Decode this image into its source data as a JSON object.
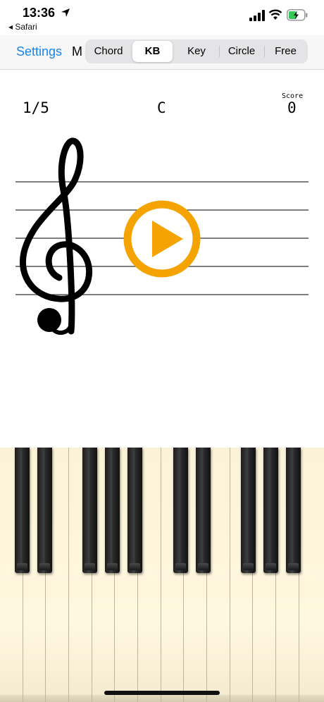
{
  "status_bar": {
    "time": "13:36",
    "back_app": "◂ Safari"
  },
  "nav": {
    "settings_label": "Settings",
    "title_fragment": "M",
    "tabs": [
      {
        "label": "Chord",
        "selected": false
      },
      {
        "label": "KB",
        "selected": true
      },
      {
        "label": "Key",
        "selected": false
      },
      {
        "label": "Circle",
        "selected": false
      },
      {
        "label": "Free",
        "selected": false
      }
    ]
  },
  "quiz": {
    "progress": "1/5",
    "chord": "C",
    "score_label": "Score",
    "score_value": "0"
  },
  "colors": {
    "accent_blue": "#1a84e6",
    "play_orange": "#f5a300",
    "key_ivory": "#fff8e0"
  },
  "icons": {
    "location": "location-arrow-icon",
    "signal": "cellular-signal-icon",
    "wifi": "wifi-icon",
    "battery": "battery-charging-icon",
    "clef": "treble-clef-icon",
    "play": "play-icon"
  },
  "keyboard": {
    "white_keys": 14,
    "black_key_groups": "2-3-2-3"
  }
}
